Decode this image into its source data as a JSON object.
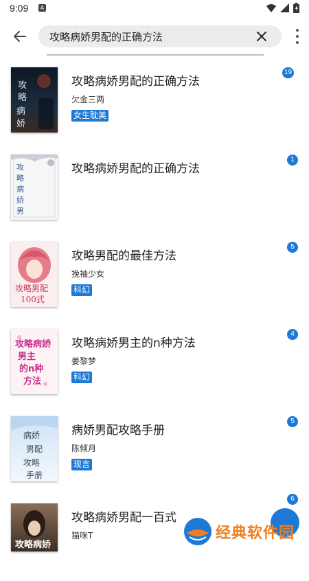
{
  "status_bar": {
    "time": "9:09"
  },
  "search": {
    "query": "攻略病娇男配的正确方法"
  },
  "colors": {
    "accent": "#1e79d6",
    "watermark": "#f07f1f"
  },
  "icons": {
    "back": "arrow-left-icon",
    "clear": "close-icon",
    "more": "more-vertical-icon"
  },
  "results": [
    {
      "title": "攻略病娇男配的正确方法",
      "author": "欠金三两",
      "tag": "女生耽美",
      "count": "19",
      "cover_text": "攻略病娇"
    },
    {
      "title": "攻略病娇男配的正确方法",
      "author": "",
      "tag": "",
      "count": "1",
      "cover_text": "攻略病娇男"
    },
    {
      "title": "攻略男配的最佳方法",
      "author": "挽袖少女",
      "tag": "科幻",
      "count": "5",
      "cover_text": "攻略男配100式"
    },
    {
      "title": "攻略病娇男主的n种方法",
      "author": "姜黎梦",
      "tag": "科幻",
      "count": "4",
      "cover_text": "攻略病娇男主的n种方法"
    },
    {
      "title": "病娇男配攻略手册",
      "author": "陈倾月",
      "tag": "现言",
      "count": "5",
      "cover_text": "病娇男配攻略手册"
    },
    {
      "title": "攻略病娇男配一百式",
      "author": "猫咪T",
      "tag": "",
      "count": "6",
      "cover_text": "攻略病娇"
    }
  ],
  "watermark": {
    "text": "经典软件园"
  }
}
